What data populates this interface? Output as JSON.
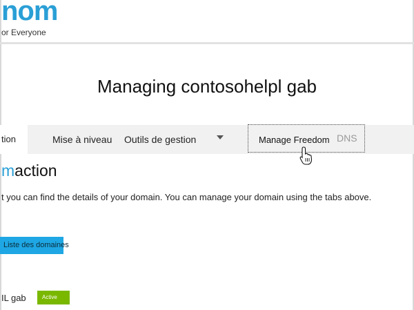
{
  "header": {
    "logo_text": "nom",
    "tagline": "or Everyone"
  },
  "page": {
    "title": "Managing contosohelpl gab"
  },
  "tabs": {
    "active_label": "tion",
    "upgrade_label": "Mise à niveau",
    "tools_label": "Outils de gestion",
    "manage_label": "Manage Freedom",
    "dns_label": "DNS"
  },
  "section": {
    "title_accent": "m",
    "title_rest": "action",
    "description": "t you can find the details of your domain. You can manage your domain using the tabs above."
  },
  "list_button": {
    "label": "Liste des domaines"
  },
  "domain_row": {
    "name": "IL gab",
    "status": "Active"
  },
  "colors": {
    "brand_blue": "#2a9fd6",
    "button_blue": "#1ea7e4",
    "active_green": "#7ab800",
    "tabbar_gray": "#f1f1f1"
  },
  "icons": {
    "cursor": "hand-pointer-icon",
    "dropdown": "caret-down-icon"
  }
}
